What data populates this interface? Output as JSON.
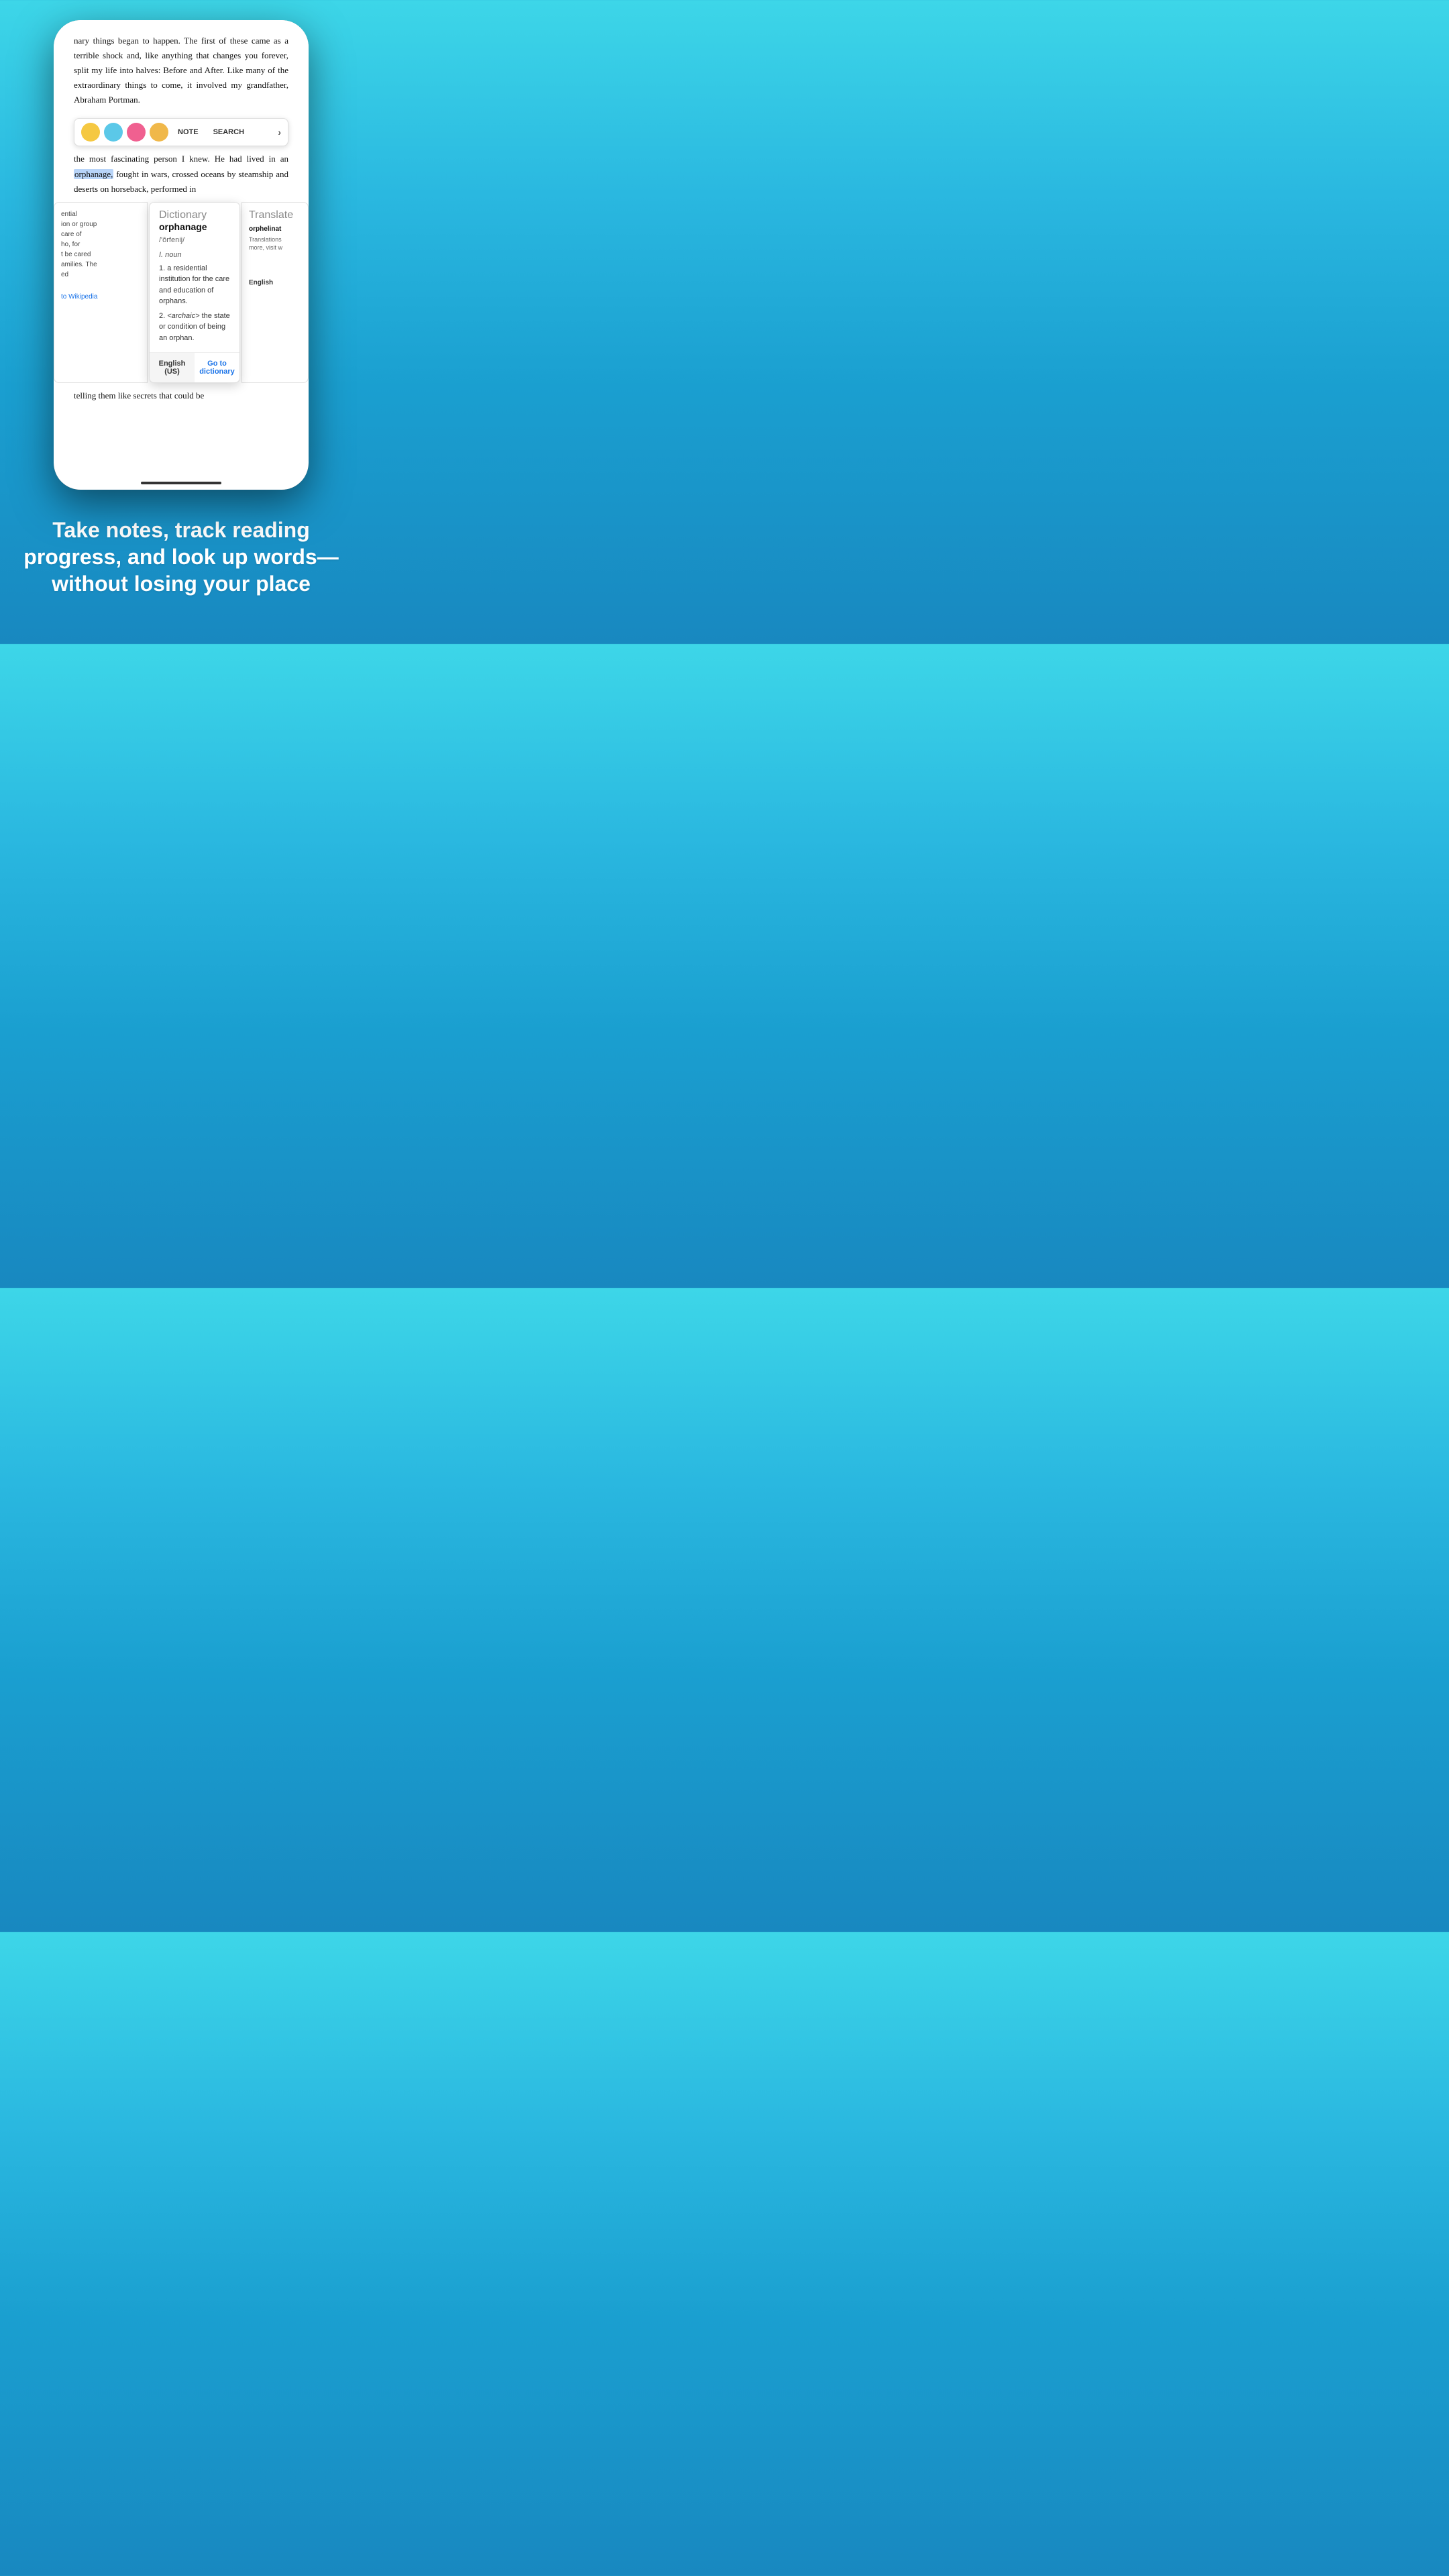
{
  "background": {
    "gradient_start": "#3dd6e8",
    "gradient_end": "#1888c0"
  },
  "book": {
    "text_top": "nary things began to happen. The first of these came as a terrible shock and, like anything that changes you forever, split my life into halves: Before and After. Like many of the extraordinary things to come, it involved my grandfather, Abraham Portman.",
    "text_mid_before": "the most fascinating person I knew. He had lived in an ",
    "highlighted_word": "orphanage,",
    "text_mid_after": " fought in wars, crossed oceans by steamship and deserts on horseback, performed in",
    "text_bottom": "telling them like secrets that could be"
  },
  "toolbar": {
    "colors": [
      "#f5c842",
      "#5bc8e8",
      "#f06090",
      "#f0b84a"
    ],
    "note_label": "NOTE",
    "search_label": "SEARCH",
    "arrow_label": "›"
  },
  "dictionary_panel": {
    "header": "Dictionary",
    "word": "orphanage",
    "pronunciation": "/'ôrfenij/",
    "part_of_speech": "I. noun",
    "definitions": [
      "a residential institution for the care and education of orphans.",
      "<archaic> the state or condition of being an orphan."
    ],
    "footer_english": "English (US)",
    "footer_go_to": "Go to dictionary"
  },
  "left_panel": {
    "text": "ential\nion or group\ncare of\nho, for\nt be cared\namilies. The\ned",
    "link": "to Wikipedia"
  },
  "right_panel": {
    "title": "Translate",
    "word": "orphelinat",
    "text": "Translations\nmore, visit w",
    "footer_label": "English"
  },
  "tagline": {
    "text": "Take notes, track reading progress, and look up words—without losing your place"
  }
}
